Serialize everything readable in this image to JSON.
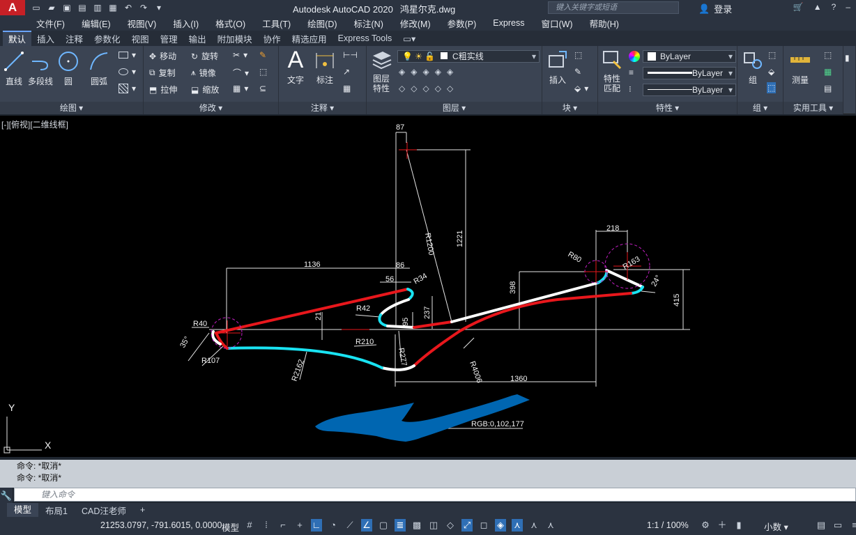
{
  "app": {
    "title": "Autodesk AutoCAD 2020",
    "file": "鸿星尔克.dwg",
    "logo": "A"
  },
  "search": {
    "placeholder": "键入关键字或短语"
  },
  "user": {
    "signin": "登录"
  },
  "menu": [
    "文件(F)",
    "编辑(E)",
    "视图(V)",
    "插入(I)",
    "格式(O)",
    "工具(T)",
    "绘图(D)",
    "标注(N)",
    "修改(M)",
    "参数(P)",
    "Express",
    "窗口(W)",
    "帮助(H)"
  ],
  "tabs": [
    "默认",
    "插入",
    "注释",
    "参数化",
    "视图",
    "管理",
    "输出",
    "附加模块",
    "协作",
    "精选应用",
    "Express Tools"
  ],
  "ribbon": {
    "draw": {
      "title": "绘图",
      "line": "直线",
      "polyline": "多段线",
      "circle": "圆",
      "arc": "圆弧"
    },
    "modify": {
      "title": "修改",
      "move": "移动",
      "rotate": "旋转",
      "copy": "复制",
      "mirror": "镜像",
      "stretch": "拉伸",
      "scale": "缩放"
    },
    "annotation": {
      "title": "注释",
      "text": "文字",
      "dimension": "标注"
    },
    "layers": {
      "title": "图层",
      "properties": "图层特性",
      "current_layer": "C粗实线"
    },
    "block": {
      "title": "块",
      "insert": "插入"
    },
    "properties": {
      "title": "特性",
      "match": "特性匹配",
      "color": "ByLayer",
      "linetype": "ByLayer",
      "lineweight": "ByLayer"
    },
    "groups": {
      "title": "组",
      "group": "组"
    },
    "utilities": {
      "title": "实用工具",
      "measure": "测量"
    }
  },
  "viewport": {
    "label": "[-][俯视][二维线框]"
  },
  "drawing": {
    "dims": [
      "87",
      "R1200",
      "1221",
      "1136",
      "86",
      "56",
      "R34",
      "R42",
      "21",
      "95",
      "237",
      "R210",
      "R277",
      "R40",
      "35°",
      "R107",
      "R2162",
      "R4006",
      "1360",
      "398",
      "218",
      "R80",
      "R163",
      "24°",
      "415"
    ],
    "rgb_note": "RGB:0,102,177",
    "colors": {
      "red": "#e8171c",
      "cyan": "#19e3f2",
      "white": "#ffffff",
      "blue_fill": "#0066b1",
      "magenta": "#c21fc2"
    }
  },
  "command": {
    "history": [
      "命令: *取消*",
      "命令: *取消*"
    ],
    "placeholder": "键入命令"
  },
  "layout_tabs": [
    "模型",
    "布局1",
    "CAD汪老师"
  ],
  "status": {
    "coords": "21253.0797, -791.6015, 0.0000",
    "model": "模型",
    "scale": "1:1 / 100%",
    "units": "小数"
  }
}
